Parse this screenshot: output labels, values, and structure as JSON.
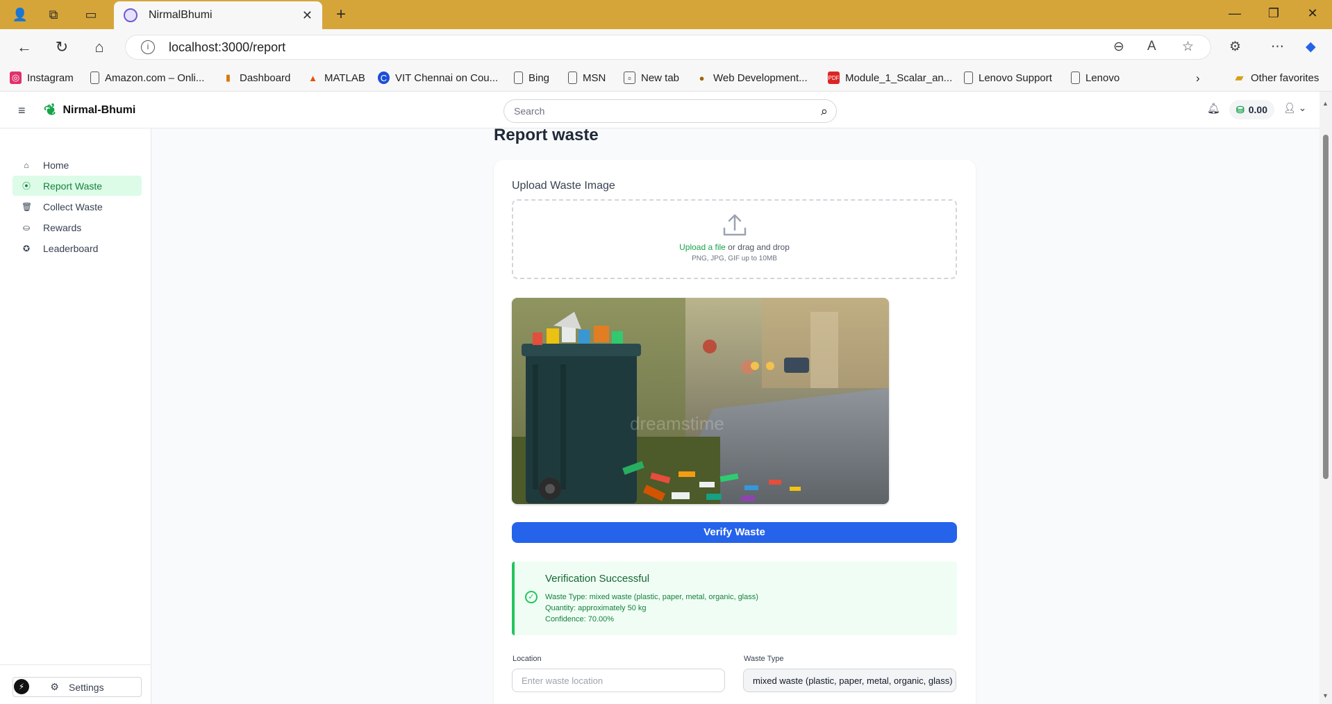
{
  "browser": {
    "tab_title": "NirmalBhumi",
    "tab_close": "✕",
    "new_tab": "+",
    "url": "localhost:3000/report",
    "bookmarks": [
      {
        "label": "Instagram",
        "icon": "instagram-icon",
        "color": "#e1306c"
      },
      {
        "label": "Amazon.com – Onli...",
        "icon": "page-icon",
        "color": "#555555"
      },
      {
        "label": "Dashboard",
        "icon": "dashboard-icon",
        "color": "#d97706"
      },
      {
        "label": "MATLAB",
        "icon": "matlab-icon",
        "color": "#e65100"
      },
      {
        "label": "VIT Chennai on Cou...",
        "icon": "coursera-icon",
        "color": "#1d4ed8"
      },
      {
        "label": "Bing",
        "icon": "page-icon",
        "color": "#555555"
      },
      {
        "label": "MSN",
        "icon": "page-icon",
        "color": "#555555"
      },
      {
        "label": "New tab",
        "icon": "newtab-icon",
        "color": "#555555"
      },
      {
        "label": "Web Development...",
        "icon": "web-icon",
        "color": "#a16207"
      },
      {
        "label": "Module_1_Scalar_an...",
        "icon": "pdf-icon",
        "color": "#dc2626"
      },
      {
        "label": "Lenovo Support",
        "icon": "page-icon",
        "color": "#555555"
      },
      {
        "label": "Lenovo",
        "icon": "page-icon",
        "color": "#555555"
      }
    ],
    "other_favorites": "Other favorites"
  },
  "header": {
    "brand": "Nirmal-Bhumi",
    "search_placeholder": "Search",
    "balance": "0.00"
  },
  "sidebar": {
    "items": [
      {
        "label": "Home",
        "icon": "home-icon",
        "active": false
      },
      {
        "label": "Report Waste",
        "icon": "map-pin-icon",
        "active": true
      },
      {
        "label": "Collect Waste",
        "icon": "trash-icon",
        "active": false
      },
      {
        "label": "Rewards",
        "icon": "coins-icon",
        "active": false
      },
      {
        "label": "Leaderboard",
        "icon": "medal-icon",
        "active": false
      }
    ],
    "settings_label": "Settings"
  },
  "main": {
    "title": "Report waste",
    "upload_label": "Upload Waste Image",
    "upload_link": "Upload a file",
    "upload_rest": " or drag and drop",
    "upload_hint": "PNG, JPG, GIF up to 10MB",
    "preview_watermark": "dreamstime",
    "verify_button": "Verify Waste",
    "verification": {
      "title": "Verification Successful",
      "waste_type": "Waste Type: mixed waste (plastic, paper, metal, organic, glass)",
      "quantity": "Quantity: approximately 50 kg",
      "confidence": "Confidence: 70.00%"
    },
    "location_label": "Location",
    "location_placeholder": "Enter waste location",
    "waste_type_label": "Waste Type",
    "waste_type_value": "mixed waste (plastic, paper, metal, organic, glass)"
  },
  "colors": {
    "accent_green": "#16a34a",
    "primary_blue": "#2563eb",
    "tab_bar": "#d6a53a"
  }
}
